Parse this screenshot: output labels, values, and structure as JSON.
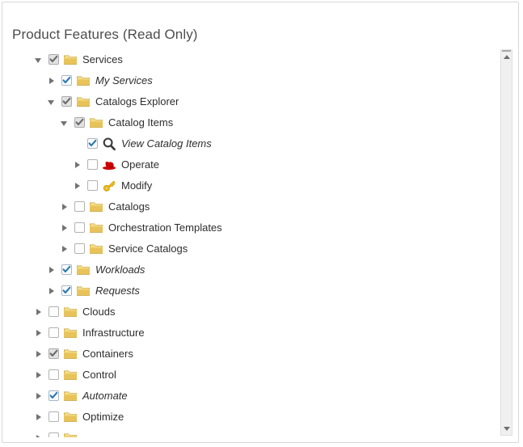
{
  "panel": {
    "title": "Product Features (Read Only)"
  },
  "colors": {
    "folder": "#e8c35a",
    "folder_edge": "#c9a43c",
    "check_blue": "#2a7ab0",
    "check_gray": "#6b6b6b",
    "redhat": "#cc0000",
    "key": "#f3c40f",
    "text": "#2e2e2e",
    "title": "#4d4d4d",
    "scroll_thumb": "#b6b6b6"
  },
  "scrollbar": {
    "up_arrow": "scroll-up-arrow",
    "down_arrow": "scroll-down-arrow",
    "thumb_top_pct": 12,
    "thumb_height_pct": 82
  },
  "tree": {
    "nodes": [
      {
        "label": "Services",
        "depth": 0,
        "twisty": "expanded",
        "check": "gray",
        "icon": "folder-icon",
        "italic": false
      },
      {
        "label": "My Services",
        "depth": 1,
        "twisty": "collapsed",
        "check": "blue",
        "icon": "folder-icon",
        "italic": true
      },
      {
        "label": "Catalogs Explorer",
        "depth": 1,
        "twisty": "expanded",
        "check": "gray",
        "icon": "folder-icon",
        "italic": false
      },
      {
        "label": "Catalog Items",
        "depth": 2,
        "twisty": "expanded",
        "check": "gray",
        "icon": "folder-icon",
        "italic": false
      },
      {
        "label": "View Catalog Items",
        "depth": 3,
        "twisty": "none",
        "check": "blue",
        "icon": "magnifier-icon",
        "italic": true
      },
      {
        "label": "Operate",
        "depth": 3,
        "twisty": "collapsed",
        "check": "empty",
        "icon": "redhat-icon",
        "italic": false
      },
      {
        "label": "Modify",
        "depth": 3,
        "twisty": "collapsed",
        "check": "empty",
        "icon": "key-icon",
        "italic": false
      },
      {
        "label": "Catalogs",
        "depth": 2,
        "twisty": "collapsed",
        "check": "empty",
        "icon": "folder-icon",
        "italic": false
      },
      {
        "label": "Orchestration Templates",
        "depth": 2,
        "twisty": "collapsed",
        "check": "empty",
        "icon": "folder-icon",
        "italic": false
      },
      {
        "label": "Service Catalogs",
        "depth": 2,
        "twisty": "collapsed",
        "check": "empty",
        "icon": "folder-icon",
        "italic": false
      },
      {
        "label": "Workloads",
        "depth": 1,
        "twisty": "collapsed",
        "check": "blue",
        "icon": "folder-icon",
        "italic": true
      },
      {
        "label": "Requests",
        "depth": 1,
        "twisty": "collapsed",
        "check": "blue",
        "icon": "folder-icon",
        "italic": true
      },
      {
        "label": "Clouds",
        "depth": 0,
        "twisty": "collapsed",
        "check": "empty",
        "icon": "folder-icon",
        "italic": false
      },
      {
        "label": "Infrastructure",
        "depth": 0,
        "twisty": "collapsed",
        "check": "empty",
        "icon": "folder-icon",
        "italic": false
      },
      {
        "label": "Containers",
        "depth": 0,
        "twisty": "collapsed",
        "check": "gray",
        "icon": "folder-icon",
        "italic": false
      },
      {
        "label": "Control",
        "depth": 0,
        "twisty": "collapsed",
        "check": "empty",
        "icon": "folder-icon",
        "italic": false
      },
      {
        "label": "Automate",
        "depth": 0,
        "twisty": "collapsed",
        "check": "blue",
        "icon": "folder-icon",
        "italic": true
      },
      {
        "label": "Optimize",
        "depth": 0,
        "twisty": "collapsed",
        "check": "empty",
        "icon": "folder-icon",
        "italic": false
      },
      {
        "label": "",
        "depth": 0,
        "twisty": "collapsed",
        "check": "empty",
        "icon": "folder-icon",
        "italic": false
      }
    ]
  }
}
